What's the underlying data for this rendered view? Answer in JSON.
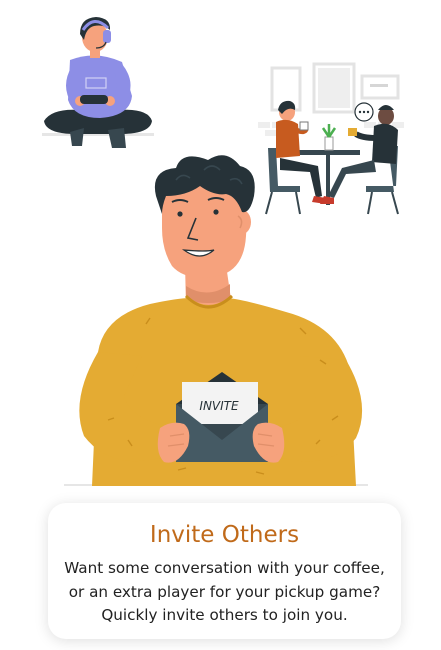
{
  "illustration": {
    "envelope_text": "INVITE"
  },
  "colors": {
    "accent": "#c06a1a",
    "sweater": "#e4ab33",
    "gamer_shirt": "#8d8ee6",
    "skin": "#f6a27d",
    "hair": "#263238"
  },
  "icons": [
    "gamer-illustration",
    "cafe-couple-illustration",
    "man-with-invite-illustration",
    "envelope-icon"
  ],
  "card": {
    "title": "Invite Others",
    "body": "Want some conversation with your coffee, or an extra player for your pickup game? Quickly invite others to join you."
  }
}
